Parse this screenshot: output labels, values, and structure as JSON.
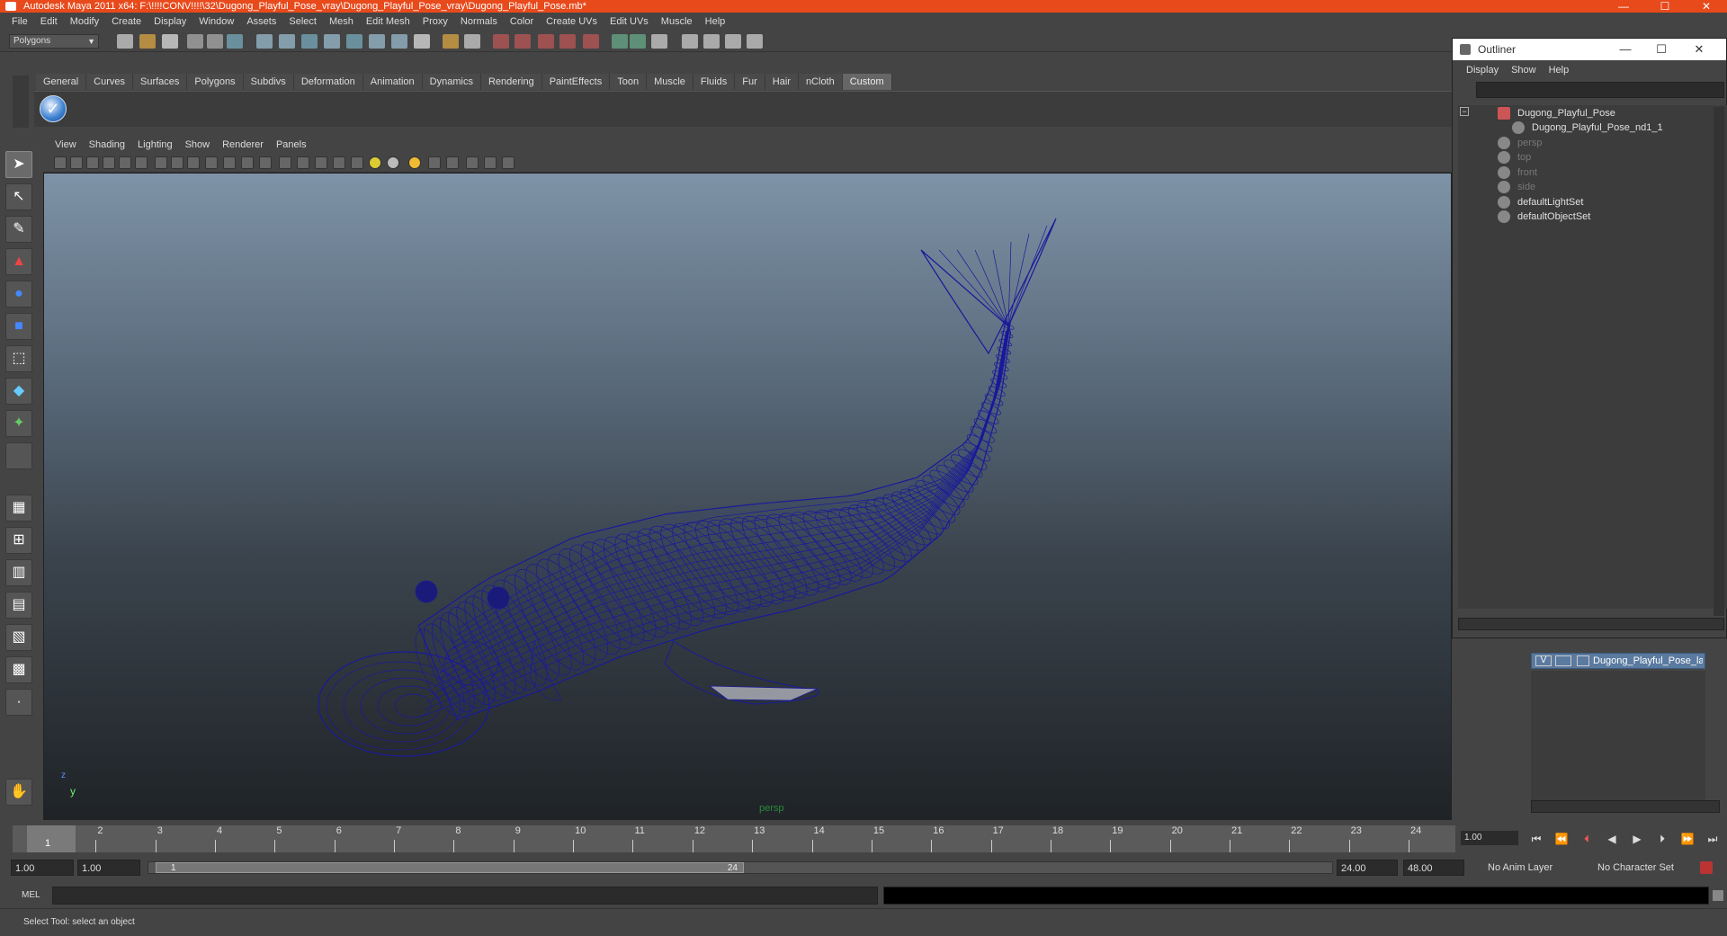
{
  "window": {
    "title": "Autodesk Maya 2011 x64: F:\\!!!!CONV!!!!\\32\\Dugong_Playful_Pose_vray\\Dugong_Playful_Pose_vray\\Dugong_Playful_Pose.mb*",
    "minimize": "—",
    "maximize": "☐",
    "close": "✕"
  },
  "menubar": [
    "File",
    "Edit",
    "Modify",
    "Create",
    "Display",
    "Window",
    "Assets",
    "Select",
    "Mesh",
    "Edit Mesh",
    "Proxy",
    "Normals",
    "Color",
    "Create UVs",
    "Edit UVs",
    "Muscle",
    "Help"
  ],
  "statusline": {
    "mode": "Polygons"
  },
  "shelf": {
    "tabs": [
      "General",
      "Curves",
      "Surfaces",
      "Polygons",
      "Subdivs",
      "Deformation",
      "Animation",
      "Dynamics",
      "Rendering",
      "PaintEffects",
      "Toon",
      "Muscle",
      "Fluids",
      "Fur",
      "Hair",
      "nCloth",
      "Custom"
    ],
    "active_tab": "Custom",
    "check_icon": "✓"
  },
  "viewport": {
    "menus": [
      "View",
      "Shading",
      "Lighting",
      "Show",
      "Renderer",
      "Panels"
    ],
    "camera_label": "persp",
    "axis_y": "y",
    "axis_z": "z",
    "wire_color": "#1a1a9a"
  },
  "outliner": {
    "title": "Outliner",
    "minimize": "—",
    "maximize": "☐",
    "close": "✕",
    "menus": [
      "Display",
      "Show",
      "Help"
    ],
    "items": [
      {
        "label": "Dugong_Playful_Pose",
        "dim": false
      },
      {
        "label": "Dugong_Playful_Pose_nd1_1",
        "dim": false
      },
      {
        "label": "persp",
        "dim": true
      },
      {
        "label": "top",
        "dim": true
      },
      {
        "label": "front",
        "dim": true
      },
      {
        "label": "side",
        "dim": true
      },
      {
        "label": "defaultLightSet",
        "dim": false
      },
      {
        "label": "defaultObjectSet",
        "dim": false
      }
    ]
  },
  "layers": {
    "visible_flag": "V",
    "layer_name": "Dugong_Playful_Pose_layer"
  },
  "timeline": {
    "ticks": [
      "1",
      "2",
      "3",
      "4",
      "5",
      "6",
      "7",
      "8",
      "9",
      "10",
      "11",
      "12",
      "13",
      "14",
      "15",
      "16",
      "17",
      "18",
      "19",
      "20",
      "21",
      "22",
      "23",
      "24"
    ],
    "current_frame": "1.00",
    "play_buttons": [
      "⏮",
      "⏪",
      "⏴",
      "◀",
      "▶",
      "⏵",
      "⏩",
      "⏭"
    ]
  },
  "range": {
    "start_time": "1.00",
    "playback_start": "1.00",
    "slider_start": "1",
    "slider_end": "24",
    "playback_end": "24.00",
    "end_time": "48.00",
    "anim_layer": "No Anim Layer",
    "character_set": "No Character Set"
  },
  "cmdline": {
    "label": "MEL"
  },
  "helpline": {
    "text": "Select Tool: select an object"
  }
}
